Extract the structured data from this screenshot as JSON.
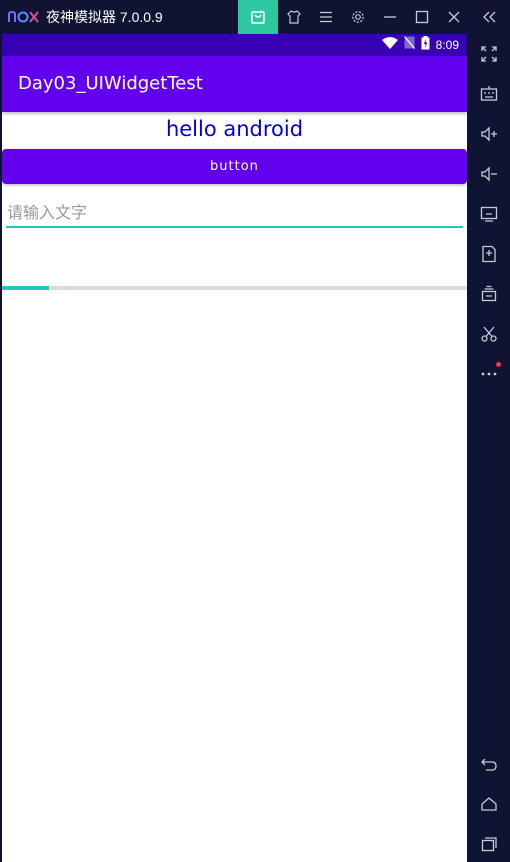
{
  "emulator": {
    "logo_text": "nox",
    "title": "夜神模拟器 7.0.0.9",
    "toolbar_icons": [
      "bag-icon",
      "shirt-icon",
      "menu-icon",
      "gear-icon",
      "minimize-icon",
      "maximize-icon",
      "close-icon",
      "collapse-icon"
    ],
    "sidebar_icons": [
      "fullscreen-icon",
      "keyboard-icon",
      "volume-up-icon",
      "volume-down-icon",
      "screen-icon",
      "apk-install-icon",
      "multi-instance-icon",
      "scissors-icon",
      "more-icon",
      "back-icon",
      "home-icon",
      "recents-icon"
    ],
    "colors": {
      "frame": "#0f1433",
      "active_button": "#2ec8a0",
      "notification_dot": "#ff3040"
    }
  },
  "android": {
    "status_bar": {
      "time": "8:09",
      "icons": [
        "wifi-icon",
        "no-sim-icon",
        "battery-icon"
      ],
      "color": "#3700b3"
    },
    "app_bar": {
      "title": "Day03_UIWidgetTest",
      "color": "#6200ee"
    },
    "content": {
      "text_view": "hello android",
      "button_label": "button",
      "edit_text": {
        "value": "",
        "placeholder": "请输入文字"
      },
      "progress": {
        "value": 0.1,
        "color": "#22c6bf"
      }
    }
  }
}
